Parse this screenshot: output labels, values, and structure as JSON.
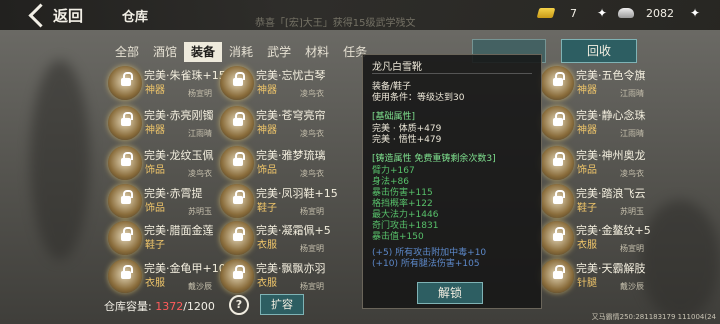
{
  "header": {
    "back_label": "返回",
    "title": "仓库",
    "marquee": "恭喜「[宏]大王」获得15级武学残文",
    "gold_value": "7",
    "silver_value": "2082"
  },
  "tabs": [
    "全部",
    "酒馆",
    "装备",
    "消耗",
    "武学",
    "材料",
    "任务"
  ],
  "active_tab": "装备",
  "recycle_label": "回收",
  "items": [
    {
      "name": "完美·朱雀珠+15",
      "cat": "神器",
      "owner": "杨宣明"
    },
    {
      "name": "完美·忘忧古琴",
      "cat": "神器",
      "owner": "凌鸟衣"
    },
    {
      "name": "完美·赤亮刚镯",
      "cat": "神器",
      "owner": "江雨晴"
    },
    {
      "name": "完美·苍穹亮帘",
      "cat": "神器",
      "owner": "凌鸟衣"
    },
    {
      "name": "完美·龙纹玉佩",
      "cat": "饰品",
      "owner": "凌鸟衣"
    },
    {
      "name": "完美·雅梦琉璃",
      "cat": "饰品",
      "owner": "凌鸟衣"
    },
    {
      "name": "完美·赤霄提",
      "cat": "饰品",
      "owner": "苏明玉"
    },
    {
      "name": "完美·凤羽鞋+15",
      "cat": "鞋子",
      "owner": "杨宣明"
    },
    {
      "name": "完美·腊面金莲",
      "cat": "鞋子",
      "owner": ""
    },
    {
      "name": "完美·凝霜佩+5",
      "cat": "衣服",
      "owner": "杨宣明"
    },
    {
      "name": "完美·金龟甲+10",
      "cat": "衣服",
      "owner": "戴沙辰"
    },
    {
      "name": "完美·飘飘亦羽",
      "cat": "衣服",
      "owner": "杨宣明"
    }
  ],
  "right_items": [
    {
      "name": "完美·五色令旗",
      "cat": "神器",
      "owner": "江雨晴"
    },
    {
      "name": "完美·静心念珠",
      "cat": "神器",
      "owner": "江雨晴"
    },
    {
      "name": "完美·神州奥龙",
      "cat": "饰品",
      "owner": "凌鸟衣"
    },
    {
      "name": "完美·踏浪飞云",
      "cat": "鞋子",
      "owner": "苏明玉"
    },
    {
      "name": "完美·金鳌纹+5",
      "cat": "衣服",
      "owner": "杨宣明"
    },
    {
      "name": "完美·天霸解肢",
      "cat": "针腿",
      "owner": "戴沙辰"
    }
  ],
  "tooltip": {
    "name": "龙凡白雪靴",
    "type": "装备/鞋子",
    "req": "使用条件：等级达到30",
    "section1": "[基础属性]",
    "attrs": [
      "完美 · 体质+479",
      "完美 · 悟性+479"
    ],
    "section2": "[铸造属性 免费重铸剩余次数3]",
    "cast": [
      "臂力+167",
      "身法+86",
      "暴击伤害+115",
      "格挡概率+122",
      "最大法力+1446",
      "奇门攻击+1831",
      "暴击值+150"
    ],
    "extra": [
      "(+5) 所有攻击附加中毒+10",
      "(+10) 所有腿法伤害+105"
    ],
    "unlock_label": "解锁"
  },
  "footer": {
    "capacity_label": "仓库容量:",
    "capacity_used": "1372",
    "capacity_total": "/1200",
    "help_label": "?",
    "expand_label": "扩容",
    "version": "又马霸情250:281183179 111004(24"
  }
}
